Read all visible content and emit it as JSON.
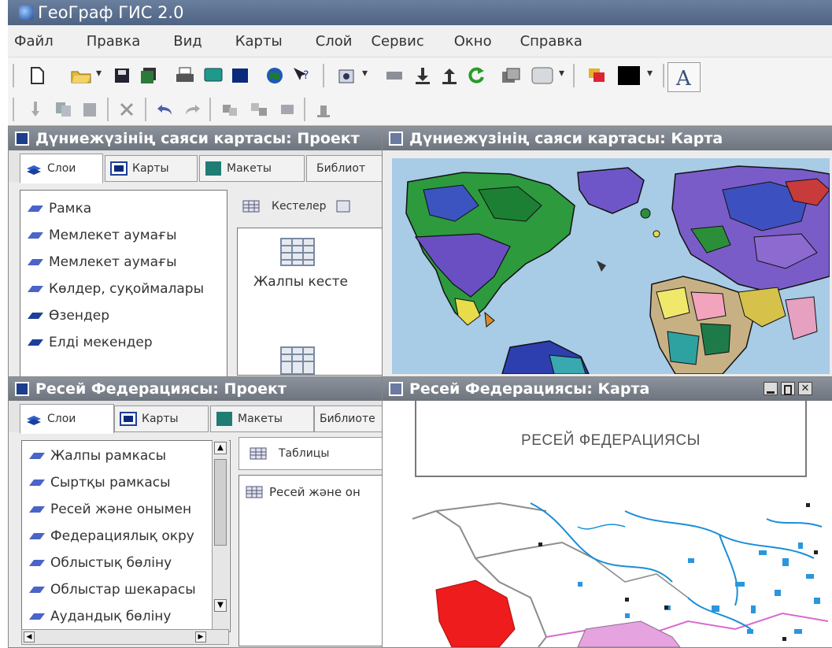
{
  "window_title": "ГеоГраф ГИС 2.0",
  "menu": [
    "Файл",
    "Правка",
    "Вид",
    "Карты",
    "Слой",
    "Сервис",
    "Окно",
    "Справка"
  ],
  "top_left": {
    "title": "Дүниежүзінің саяси картасы: Проект",
    "tabs": [
      "Слои",
      "Карты",
      "Макеты",
      "Библиот"
    ],
    "layers": [
      "Рамка",
      "Мемлекет аумағы",
      "Мемлекет аумағы",
      "Көлдер, суқоймалары",
      "Өзендер",
      "Елді мекендер"
    ],
    "subtabs": [
      "Кестелер"
    ],
    "table_label": "Жалпы кесте"
  },
  "top_right": {
    "title": "Дүниежүзінің саяси картасы: Карта"
  },
  "bottom_left": {
    "title": "Ресей Федерациясы: Проект",
    "tabs": [
      "Слои",
      "Карты",
      "Макеты",
      "Библиоте"
    ],
    "layers": [
      "Жалпы рамкасы",
      "Сыртқы рамкасы",
      "Ресей және онымен",
      "Федерациялық окру",
      "Облыстық бөліну",
      "Облыстар шекарасы",
      "Аудандық бөліну"
    ],
    "subtabs": [
      "Таблицы"
    ],
    "table_item": "Ресей және он"
  },
  "bottom_right": {
    "title": "Ресей Федерациясы: Карта",
    "map_title": "РЕСЕЙ ФЕДЕРАЦИЯСЫ"
  },
  "colors": {
    "title_bar": "#5a6e8e",
    "window_title": "#7b818a",
    "ocean": "#a8cbe6",
    "red_region": "#ee1c1c"
  }
}
